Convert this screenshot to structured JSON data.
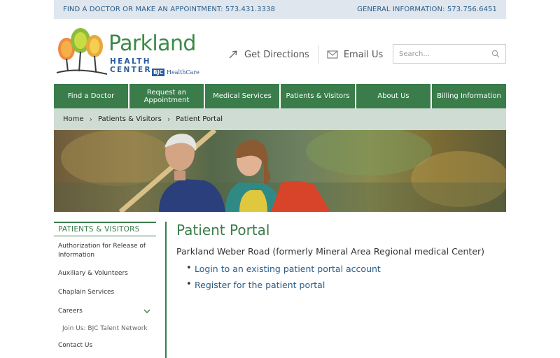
{
  "topbar": {
    "left_text": "FIND A DOCTOR OR MAKE AN APPOINTMENT: 573.431.3338",
    "right_text": "GENERAL INFORMATION: 573.756.6451"
  },
  "logo": {
    "name": "Parkland",
    "subtitle": "HEALTH CENTER",
    "bjc_box": "BJC",
    "bjc_text": "HealthCare"
  },
  "header": {
    "directions_label": "Get Directions",
    "email_label": "Email Us",
    "search_placeholder": "Search..."
  },
  "nav": {
    "items": [
      {
        "label": "Find a Doctor"
      },
      {
        "label": "Request an Appointment"
      },
      {
        "label": "Medical Services"
      },
      {
        "label": "Patients & Visitors"
      },
      {
        "label": "About Us"
      },
      {
        "label": "Billing Information"
      }
    ]
  },
  "breadcrumb": {
    "items": [
      "Home",
      "Patients & Visitors",
      "Patient Portal"
    ]
  },
  "sidebar": {
    "heading": "PATIENTS & VISITORS",
    "items": [
      {
        "label": "Authorization for Release of Information"
      },
      {
        "label": "Auxiliary & Volunteers"
      },
      {
        "label": "Chaplain Services"
      },
      {
        "label": "Careers"
      }
    ],
    "sub_item": "Join Us: BJC Talent Network",
    "contact": "Contact Us"
  },
  "content": {
    "title": "Patient Portal",
    "location": "Parkland Weber Road (formerly Mineral Area Regional medical Center)",
    "links": [
      {
        "label": "Login to an existing patient portal account"
      },
      {
        "label": "Register for the patient portal"
      }
    ]
  },
  "colors": {
    "brand_green": "#3a7d4b",
    "link_blue": "#2a5d8a",
    "topbar_bg": "#dfe6ee",
    "breadcrumb_bg": "#cfdcd3"
  }
}
